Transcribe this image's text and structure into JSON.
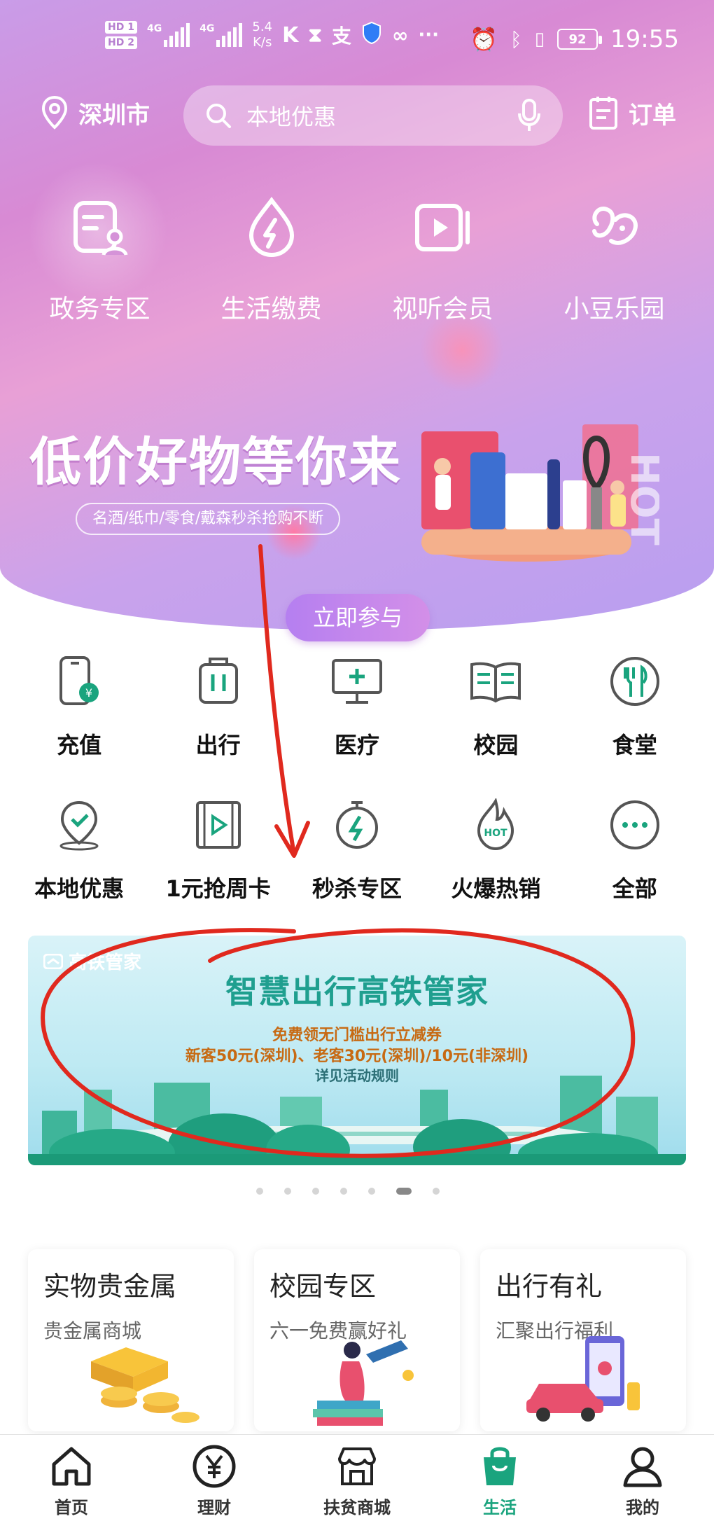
{
  "status_bar": {
    "hd1": "HD 1",
    "hd2": "HD 2",
    "net1": "4G",
    "net2": "4G",
    "speed_value": "5.4",
    "speed_unit": "K/s",
    "battery": "92",
    "time": "19:55"
  },
  "header": {
    "location": "深圳市",
    "search_placeholder": "本地优惠",
    "orders": "订单"
  },
  "quick_links": [
    {
      "label": "政务专区",
      "icon": "document-person-icon"
    },
    {
      "label": "生活缴费",
      "icon": "flame-bolt-icon"
    },
    {
      "label": "视听会员",
      "icon": "video-play-icon"
    },
    {
      "label": "小豆乐园",
      "icon": "bean-icon"
    }
  ],
  "promo": {
    "title": "低价好物等你来",
    "subtitle": "名酒/纸巾/零食/戴森秒杀抢购不断",
    "join_button": "立即参与"
  },
  "services": [
    {
      "label": "充值",
      "icon": "phone-recharge-icon"
    },
    {
      "label": "出行",
      "icon": "luggage-icon"
    },
    {
      "label": "医疗",
      "icon": "medical-monitor-icon"
    },
    {
      "label": "校园",
      "icon": "open-book-icon"
    },
    {
      "label": "食堂",
      "icon": "fork-knife-icon"
    },
    {
      "label": "本地优惠",
      "icon": "location-check-icon"
    },
    {
      "label": "1元抢周卡",
      "icon": "film-play-icon"
    },
    {
      "label": "秒杀专区",
      "icon": "stopwatch-bolt-icon"
    },
    {
      "label": "火爆热销",
      "icon": "hot-flame-icon"
    },
    {
      "label": "全部",
      "icon": "more-dots-icon"
    }
  ],
  "rail_banner": {
    "brand": "高铁管家",
    "title": "智慧出行高铁管家",
    "line1": "免费领无门槛出行立减券",
    "line2": "新客50元(深圳)、老客30元(深圳)/10元(非深圳)",
    "line3": "详见活动规则"
  },
  "carousel": {
    "count": 7,
    "active_index": 5
  },
  "cards": [
    {
      "title": "实物贵金属",
      "subtitle": "贵金属商城"
    },
    {
      "title": "校园专区",
      "subtitle": "六一免费赢好礼"
    },
    {
      "title": "出行有礼",
      "subtitle": "汇聚出行福利"
    }
  ],
  "tabs": [
    {
      "label": "首页",
      "icon": "home-icon",
      "active": false
    },
    {
      "label": "理财",
      "icon": "yen-circle-icon",
      "active": false
    },
    {
      "label": "扶贫商城",
      "icon": "shop-icon",
      "active": false
    },
    {
      "label": "生活",
      "icon": "shopping-bag-icon",
      "active": true
    },
    {
      "label": "我的",
      "icon": "user-icon",
      "active": false
    }
  ],
  "colors": {
    "accent_green": "#1aa47e",
    "annotation_red": "#e0291e",
    "hero_purple": "#c99ce8"
  }
}
